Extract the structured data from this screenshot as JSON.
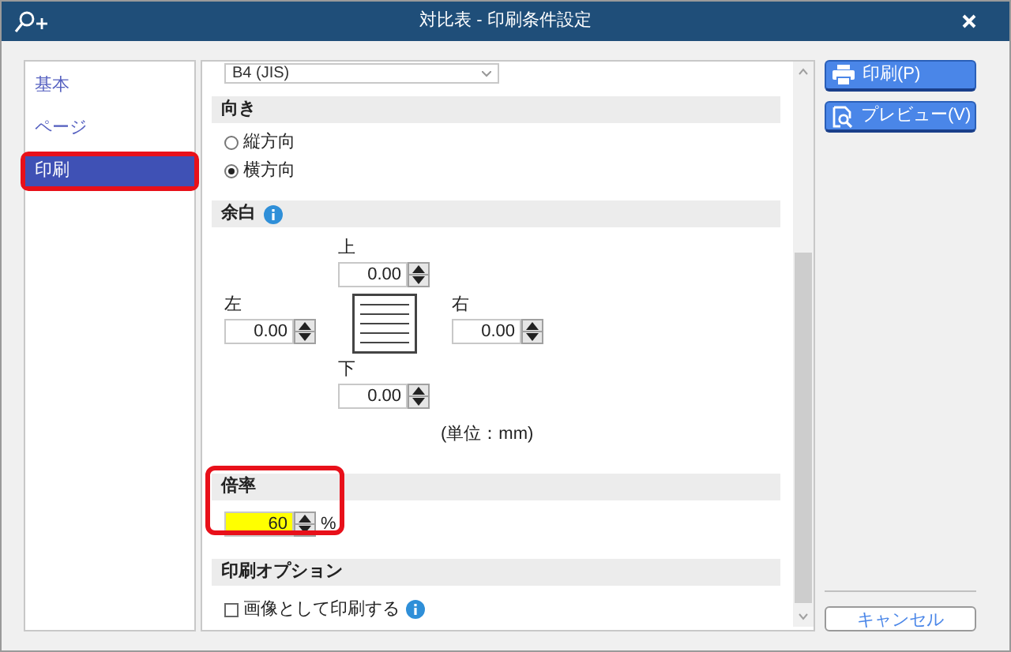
{
  "window": {
    "title": "対比表 - 印刷条件設定"
  },
  "sidebar": {
    "items": [
      {
        "label": "基本",
        "selected": false,
        "highlighted": false
      },
      {
        "label": "ページ",
        "selected": false,
        "highlighted": false
      },
      {
        "label": "印刷",
        "selected": true,
        "highlighted": true
      }
    ]
  },
  "paper_size": {
    "value": "B4 (JIS)"
  },
  "orientation": {
    "heading": "向き",
    "options": [
      {
        "label": "縦方向",
        "selected": false
      },
      {
        "label": "横方向",
        "selected": true
      }
    ]
  },
  "margins": {
    "heading": "余白",
    "top": {
      "label": "上",
      "value": "0.00"
    },
    "left": {
      "label": "左",
      "value": "0.00"
    },
    "right": {
      "label": "右",
      "value": "0.00"
    },
    "bottom": {
      "label": "下",
      "value": "0.00"
    },
    "unit": "(単位：mm)"
  },
  "scale": {
    "heading": "倍率",
    "value": "60",
    "unit": "%",
    "highlighted": true
  },
  "print_options": {
    "heading": "印刷オプション",
    "items": [
      {
        "label": "画像として印刷する",
        "checked": false
      }
    ]
  },
  "buttons": [
    {
      "label": "印刷(P)",
      "kind": "print"
    },
    {
      "label": "プレビュー(V)",
      "kind": "preview"
    }
  ],
  "cancel": {
    "label": "キャンセル"
  }
}
